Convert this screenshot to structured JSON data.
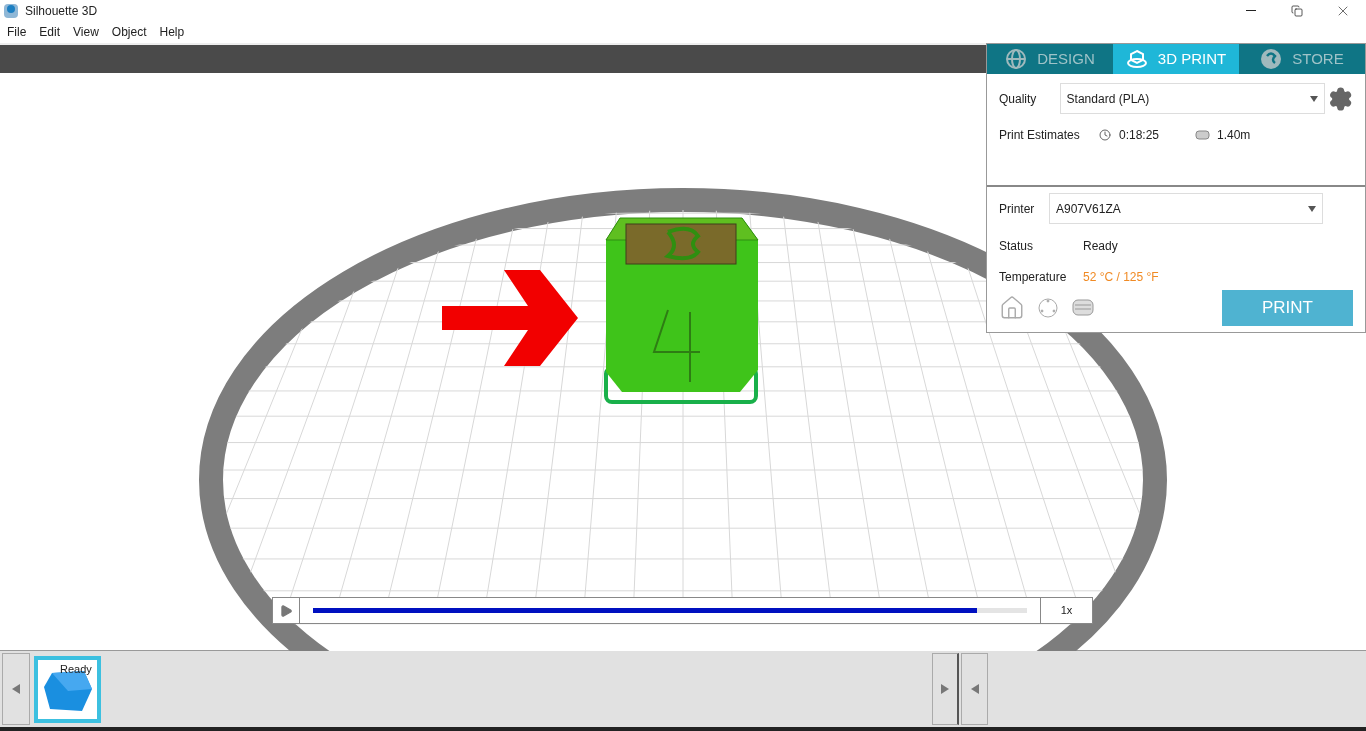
{
  "window": {
    "title": "Silhouette 3D"
  },
  "menu": [
    "File",
    "Edit",
    "View",
    "Object",
    "Help"
  ],
  "tabs": [
    {
      "label": "DESIGN",
      "selected": false
    },
    {
      "label": "3D PRINT",
      "selected": true
    },
    {
      "label": "STORE",
      "selected": false
    }
  ],
  "quality": {
    "label": "Quality",
    "value": "Standard (PLA)"
  },
  "estimates": {
    "label": "Print Estimates",
    "time": "0:18:25",
    "filament": "1.40m"
  },
  "printer": {
    "label": "Printer",
    "value": "A907V61ZA"
  },
  "status": {
    "label": "Status",
    "value": "Ready"
  },
  "temperature": {
    "label": "Temperature",
    "value": "52 °C / 125 °F"
  },
  "print_button": "PRINT",
  "playback": {
    "level": 0.93,
    "speed": "1x"
  },
  "thumbnails": [
    {
      "label": "Ready",
      "selected": true
    }
  ]
}
